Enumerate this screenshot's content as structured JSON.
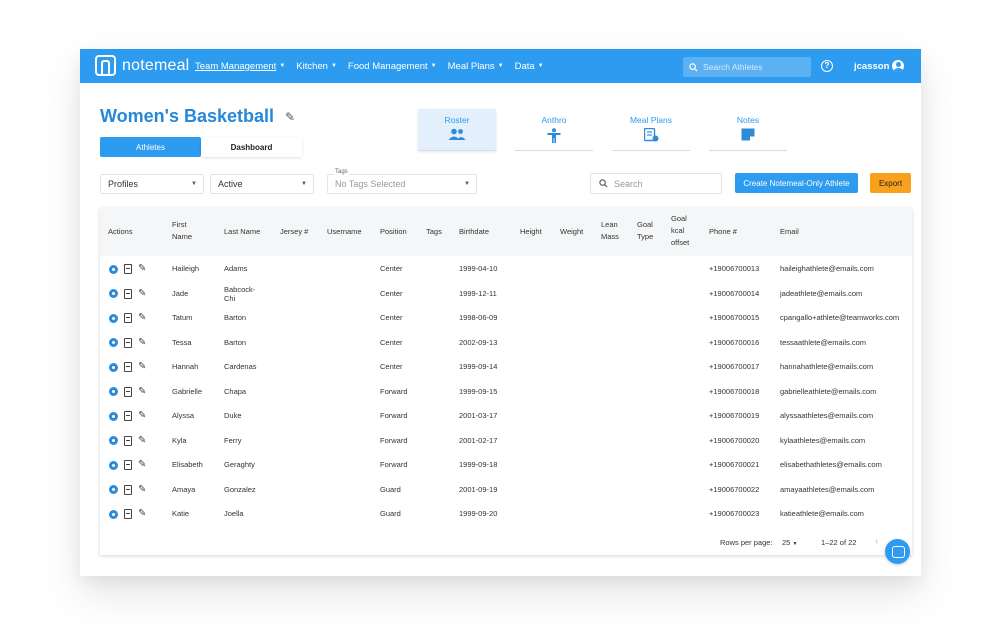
{
  "app": {
    "brand": "notemeal"
  },
  "nav": {
    "items": [
      {
        "label": "Team Management",
        "active": true
      },
      {
        "label": "Kitchen"
      },
      {
        "label": "Food Management"
      },
      {
        "label": "Meal Plans"
      },
      {
        "label": "Data"
      }
    ],
    "search_placeholder": "Search Athletes",
    "username": "jcasson"
  },
  "team": {
    "title": "Women's Basketball"
  },
  "subtabs": {
    "athletes": "Athletes",
    "dashboard": "Dashboard"
  },
  "section_tabs": [
    {
      "label": "Roster",
      "icon": "people-icon",
      "active": true
    },
    {
      "label": "Anthro",
      "icon": "body-icon"
    },
    {
      "label": "Meal Plans",
      "icon": "meal-plan-icon"
    },
    {
      "label": "Notes",
      "icon": "note-icon"
    }
  ],
  "filters": {
    "profiles": "Profiles",
    "status": "Active",
    "tags_label": "Tags",
    "tags_value": "No Tags Selected",
    "search_placeholder": "Search"
  },
  "buttons": {
    "create": "Create Notemeal-Only Athlete",
    "export": "Export"
  },
  "table": {
    "headers": {
      "actions": "Actions",
      "first_name": "First Name",
      "last_name": "Last Name",
      "jersey": "Jersey #",
      "username": "Username",
      "position": "Position",
      "tags": "Tags",
      "birthdate": "Birthdate",
      "height": "Height",
      "weight": "Weight",
      "lean_mass": "Lean Mass",
      "goal_type": "Goal Type",
      "goal_offset": "Goal kcal offset",
      "phone": "Phone #",
      "email": "Email"
    },
    "rows": [
      {
        "first": "Haileigh",
        "last": "Adams",
        "position": "Center",
        "birthdate": "1999-04-10",
        "phone": "+19006700013",
        "email": "haileighathlete@emails.com"
      },
      {
        "first": "Jade",
        "last": "Babcock-Chi",
        "position": "Center",
        "birthdate": "1999-12-11",
        "phone": "+19006700014",
        "email": "jadeathlete@emails.com"
      },
      {
        "first": "Tatum",
        "last": "Barton",
        "position": "Center",
        "birthdate": "1998-06-09",
        "phone": "+19006700015",
        "email": "cpangallo+athlete@teamworks.com"
      },
      {
        "first": "Tessa",
        "last": "Barton",
        "position": "Center",
        "birthdate": "2002-09-13",
        "phone": "+19006700016",
        "email": "tessaathlete@emails.com"
      },
      {
        "first": "Hannah",
        "last": "Cardenas",
        "position": "Center",
        "birthdate": "1999-09-14",
        "phone": "+19006700017",
        "email": "hannahathlete@emails.com"
      },
      {
        "first": "Gabrielle",
        "last": "Chapa",
        "position": "Forward",
        "birthdate": "1999-09-15",
        "phone": "+19006700018",
        "email": "gabrielleathlete@emails.com"
      },
      {
        "first": "Alyssa",
        "last": "Duke",
        "position": "Forward",
        "birthdate": "2001-03-17",
        "phone": "+19006700019",
        "email": "alyssaathletes@emails.com"
      },
      {
        "first": "Kyla",
        "last": "Ferry",
        "position": "Forward",
        "birthdate": "2001-02-17",
        "phone": "+19006700020",
        "email": "kylaathletes@emails.com"
      },
      {
        "first": "Elisabeth",
        "last": "Geraghty",
        "position": "Forward",
        "birthdate": "1999-09-18",
        "phone": "+19006700021",
        "email": "elisabethathletes@emails.com"
      },
      {
        "first": "Amaya",
        "last": "Gonzalez",
        "position": "Guard",
        "birthdate": "2001-09-19",
        "phone": "+19006700022",
        "email": "amayaathletes@emails.com"
      },
      {
        "first": "Katie",
        "last": "Joella",
        "position": "Guard",
        "birthdate": "1999-09-20",
        "phone": "+19006700023",
        "email": "katieathlete@emails.com"
      }
    ]
  },
  "pagination": {
    "rows_per_page_label": "Rows per page:",
    "rows_per_page": "25",
    "range": "1–22 of 22"
  }
}
